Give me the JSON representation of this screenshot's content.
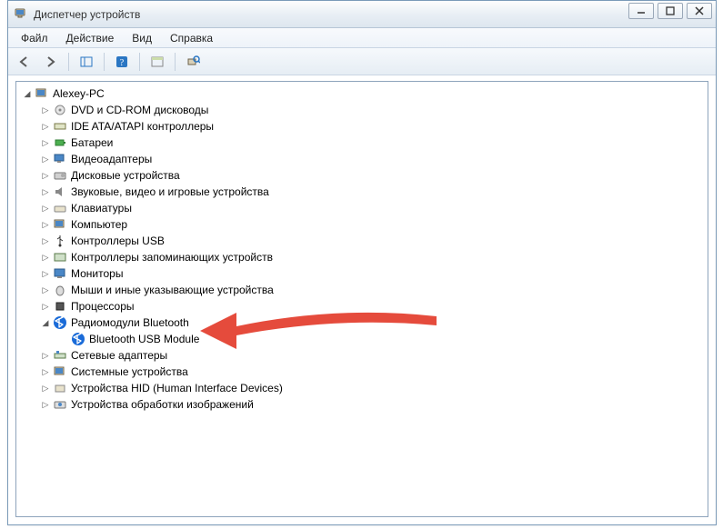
{
  "window": {
    "title": "Диспетчер устройств"
  },
  "menu": {
    "file": "Файл",
    "action": "Действие",
    "view": "Вид",
    "help": "Справка"
  },
  "tree": {
    "root": "Alexey-PC",
    "items": [
      {
        "label": "DVD и CD-ROM дисководы"
      },
      {
        "label": "IDE ATA/ATAPI контроллеры"
      },
      {
        "label": "Батареи"
      },
      {
        "label": "Видеоадаптеры"
      },
      {
        "label": "Дисковые устройства"
      },
      {
        "label": "Звуковые, видео и игровые устройства"
      },
      {
        "label": "Клавиатуры"
      },
      {
        "label": "Компьютер"
      },
      {
        "label": "Контроллеры USB"
      },
      {
        "label": "Контроллеры запоминающих устройств"
      },
      {
        "label": "Мониторы"
      },
      {
        "label": "Мыши и иные указывающие устройства"
      },
      {
        "label": "Процессоры"
      },
      {
        "label": "Радиомодули Bluetooth",
        "expanded": true,
        "children": [
          {
            "label": "Bluetooth USB Module"
          }
        ]
      },
      {
        "label": "Сетевые адаптеры"
      },
      {
        "label": "Системные устройства"
      },
      {
        "label": "Устройства HID (Human Interface Devices)"
      },
      {
        "label": "Устройства обработки изображений"
      }
    ]
  }
}
